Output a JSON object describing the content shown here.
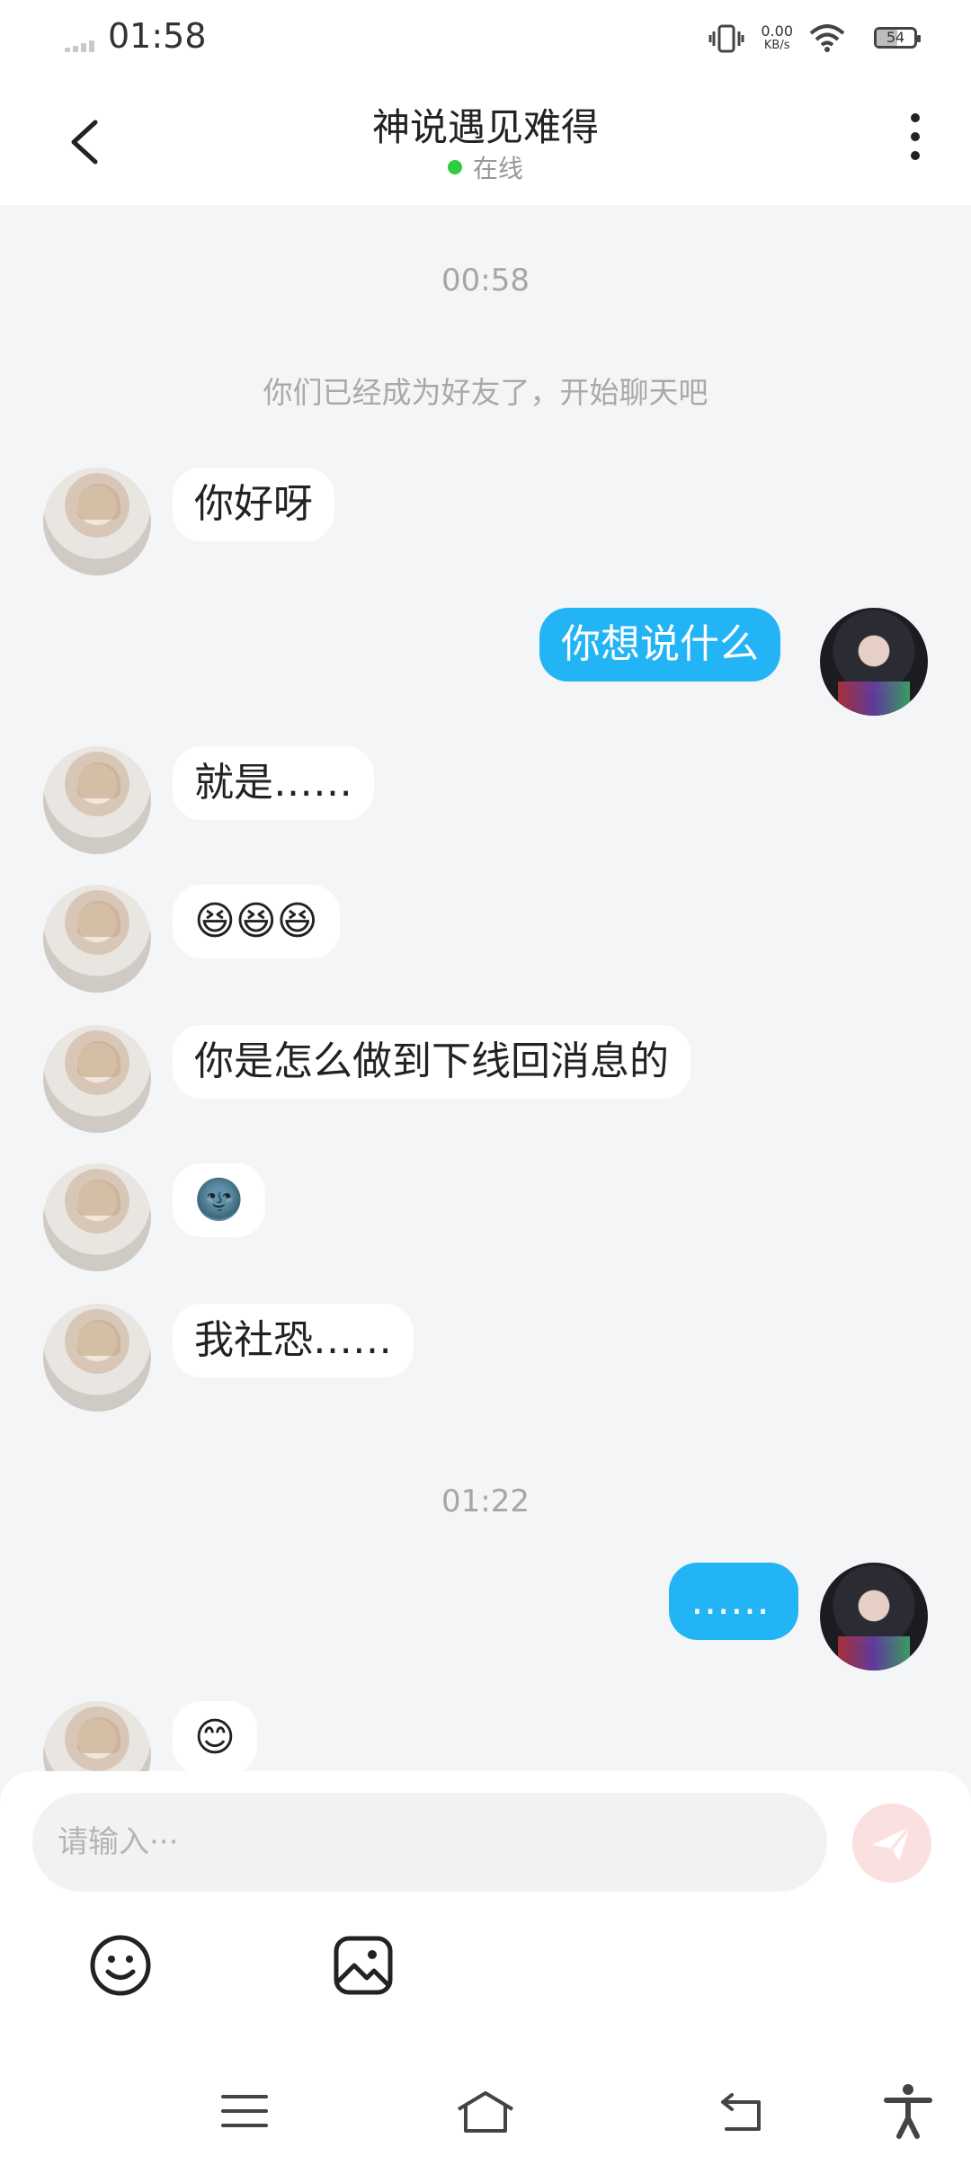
{
  "status_bar": {
    "time": "01:58",
    "net_speed_value": "0.00",
    "net_speed_unit": "KB/s",
    "battery": "54"
  },
  "header": {
    "title": "神说遇见难得",
    "status": "在线"
  },
  "chat": {
    "timestamp_1": "00:58",
    "system_message": "你们已经成为好友了，开始聊天吧",
    "messages": [
      {
        "side": "in",
        "text": "你好呀"
      },
      {
        "side": "out",
        "text": "你想说什么"
      },
      {
        "side": "in",
        "text": "就是……"
      },
      {
        "side": "in",
        "text": "😆😆😆"
      },
      {
        "side": "in",
        "text": "你是怎么做到下线回消息的"
      },
      {
        "side": "in",
        "text": "🌚"
      },
      {
        "side": "in",
        "text": "我社恐……"
      },
      {
        "side": "out",
        "text": "……"
      },
      {
        "side": "in",
        "text": "😊"
      }
    ],
    "timestamp_2": "01:22"
  },
  "input": {
    "placeholder": "请输入···"
  },
  "icons": [
    "back-icon",
    "more-icon",
    "emoji-icon",
    "image-icon",
    "send-icon",
    "menu-icon",
    "home-icon",
    "back-nav-icon",
    "accessibility-icon"
  ],
  "colors": {
    "outgoing_bubble": "#22b4f5",
    "online_dot": "#2ecc40",
    "send_button": "#fbe0e0"
  }
}
